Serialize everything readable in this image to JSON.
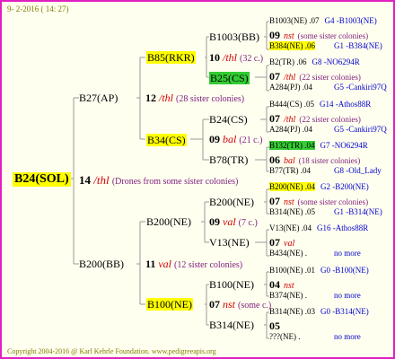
{
  "header": {
    "date": "9- 2-2016 ( 14: 27)"
  },
  "root": {
    "code": "B24(SOL)",
    "num": "14",
    "tag": "/thl",
    "note": "(Drones from some sister colonies)"
  },
  "g1": [
    {
      "code": "B27(AP)",
      "num": "12",
      "tag": "/thl",
      "note": "(28 sister colonies)"
    },
    {
      "code": "B200(BB)",
      "num": "11",
      "tag": "val",
      "note": "(12 sister colonies)"
    }
  ],
  "g2": [
    {
      "code": "B85(RKR)",
      "num": "10",
      "tag": "/thl",
      "note": "(32 c.)"
    },
    {
      "code": "B34(CS)",
      "num": "09",
      "tag": "bal",
      "note": "(21 c.)"
    },
    {
      "code": "B200(NE)",
      "num": "09",
      "tag": "val",
      "note": "(7 c.)"
    },
    {
      "code": "B100(NE)",
      "num": "07",
      "tag": "nst",
      "note": "(some c.)"
    }
  ],
  "g3": [
    {
      "code": "B1003(BB)"
    },
    {
      "code": "B25(CS)"
    },
    {
      "code": "B24(CS)"
    },
    {
      "code": "B78(TR)"
    },
    {
      "code": "B200(NE)"
    },
    {
      "code": "V13(NE)"
    },
    {
      "code": "B100(NE)"
    },
    {
      "code": "B314(NE)"
    }
  ],
  "g4": [
    {
      "a": "B1003(NE) .07",
      "b": "G4 -B1003(NE)",
      "num": "09",
      "tag": "nst",
      "note": "(some sister colonies)",
      "c": "B384(NE) .06",
      "d": "G1 -B384(NE)"
    },
    {
      "a": "B2(TR) .06",
      "b": "G8 -NO6294R",
      "num": "07",
      "tag": "/thl",
      "note": "(22 sister colonies)",
      "c": "A284(PJ) .04",
      "d": "G5 -Cankiri97Q"
    },
    {
      "a": "B444(CS) .05",
      "b": "G14 -Athos88R",
      "num": "07",
      "tag": "/thl",
      "note": "(22 sister colonies)",
      "c": "A284(PJ) .04",
      "d": "G5 -Cankiri97Q"
    },
    {
      "a": "B132(TR) .04",
      "b": "G7 -NO6294R",
      "num": "06",
      "tag": "bal",
      "note": "(18 sister colonies)",
      "c": "B77(TR) .04",
      "d": "G8 -Old_Lady"
    },
    {
      "a": "B200(NE) .04",
      "b": "G2 -B200(NE)",
      "num": "07",
      "tag": "nst",
      "note": "(some sister colonies)",
      "c": "B314(NE) .05",
      "d": "G1 -B314(NE)"
    },
    {
      "a": "V13(NE) .04",
      "b": "G16 -Athos88R",
      "num": "07",
      "tag": "val",
      "note": "",
      "c": "B434(NE) .",
      "d": "no more"
    },
    {
      "a": "B100(NE) .01",
      "b": "G0 -B100(NE)",
      "num": "04",
      "tag": "nst",
      "note": "",
      "c": "B374(NE) .",
      "d": "no more"
    },
    {
      "a": "B314(NE) .03",
      "b": "G0 -B314(NE)",
      "num": "05",
      "tag": "",
      "note": "",
      "c": "???(NE) .",
      "d": "no more"
    }
  ],
  "footer": {
    "text": "Copyright 2004-2016 @ Karl Kehrle Foundation.   www.pedigreeapis.org"
  }
}
